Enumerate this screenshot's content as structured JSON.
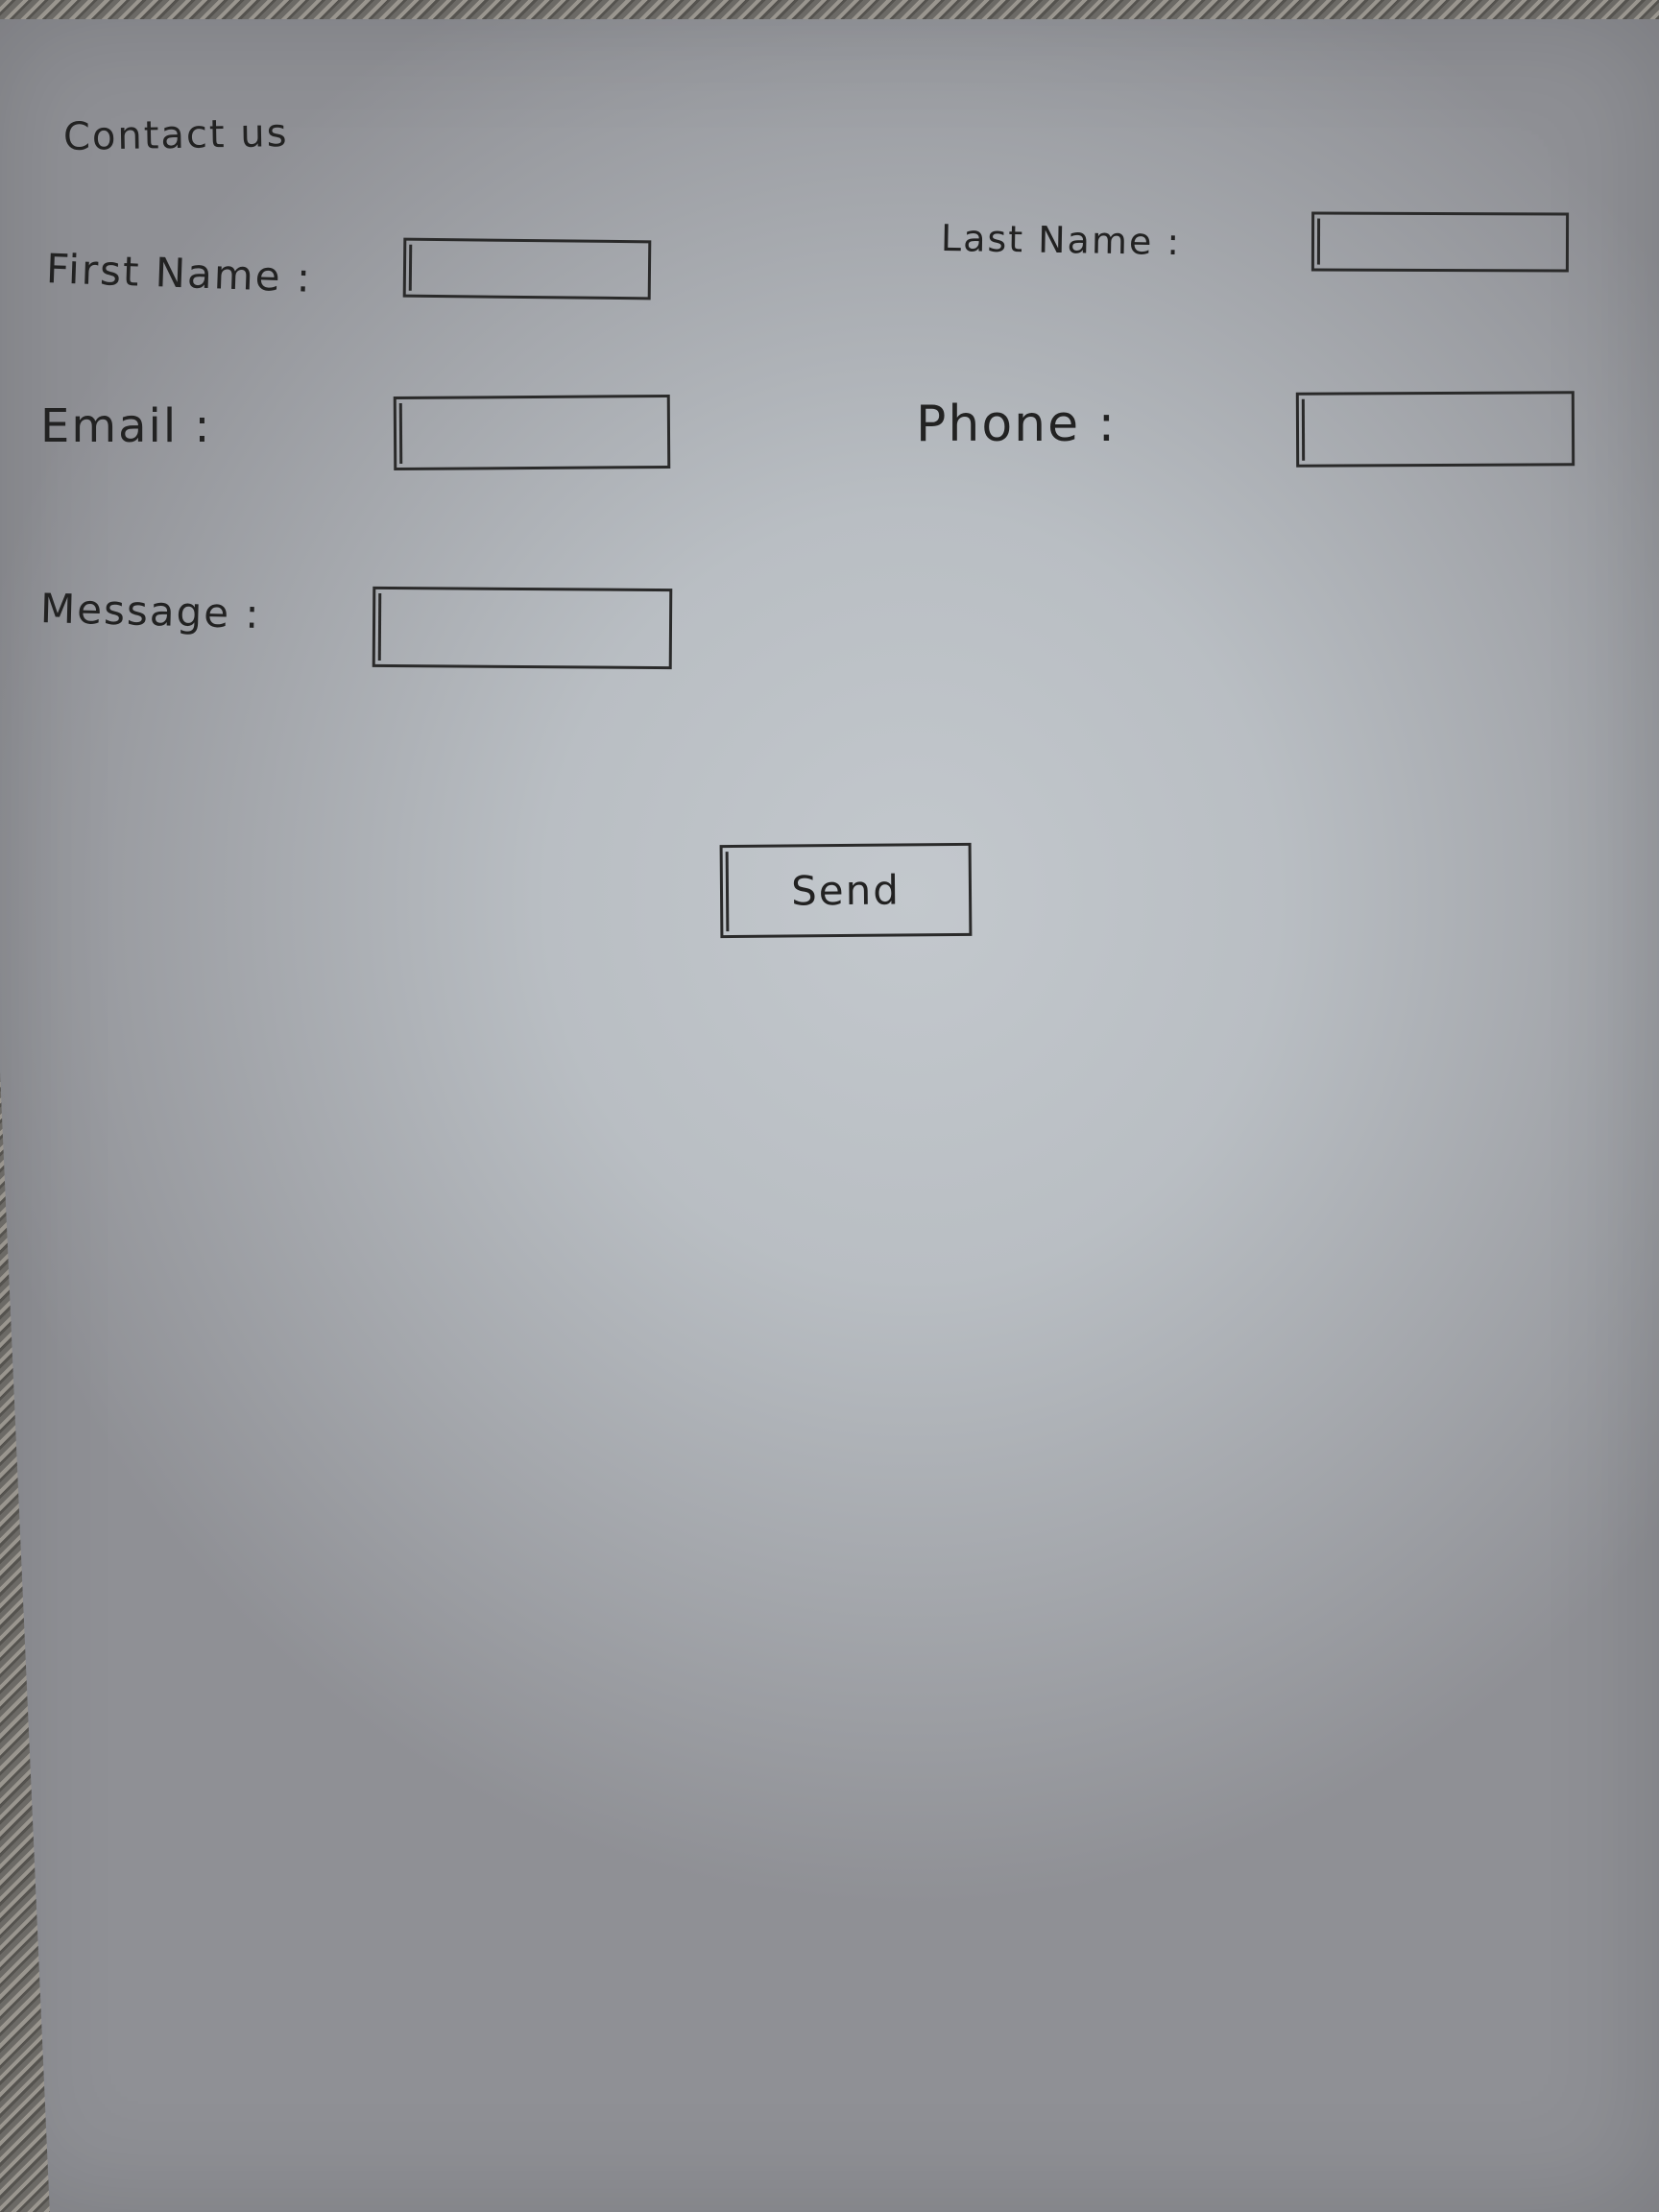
{
  "form": {
    "title": "Contact us",
    "first_name_label": "First Name :",
    "last_name_label": "Last Name :",
    "email_label": "Email :",
    "phone_label": "Phone :",
    "message_label": "Message :",
    "first_name_value": "",
    "last_name_value": "",
    "email_value": "",
    "phone_value": "",
    "message_value": "",
    "send_label": "Send"
  }
}
